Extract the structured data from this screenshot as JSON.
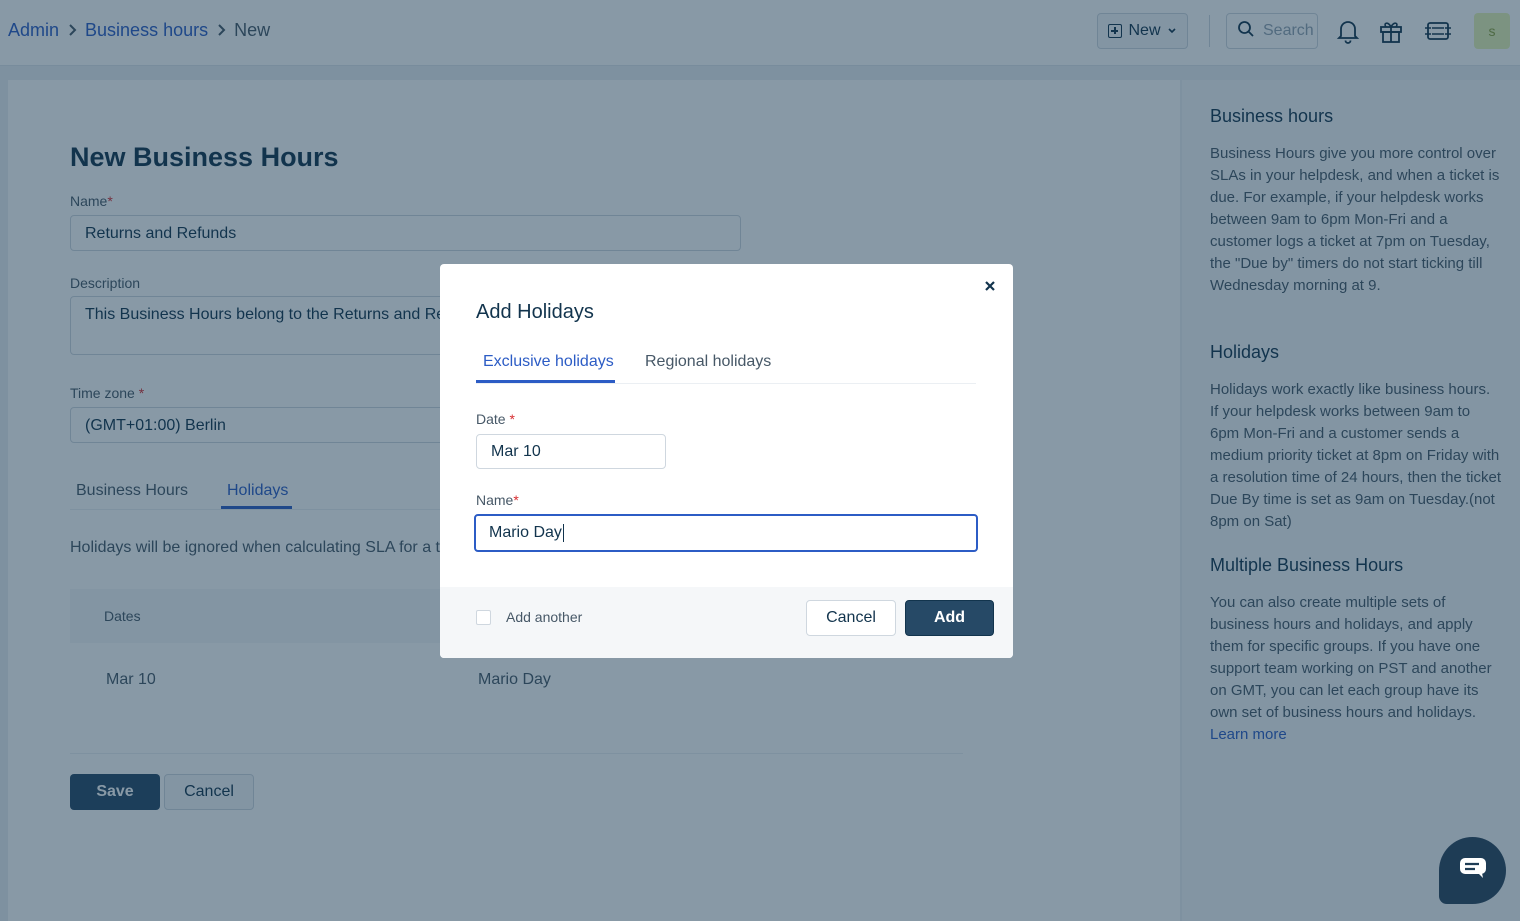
{
  "breadcrumb": {
    "items": [
      "Admin",
      "Business hours"
    ],
    "current": "New"
  },
  "topbar": {
    "new_label": "New",
    "search_placeholder": "Search",
    "avatar_initial": "s",
    "icons": [
      "plus-square-icon",
      "chevron-down-icon",
      "search-icon",
      "bell-icon",
      "gift-icon",
      "tickets-icon"
    ]
  },
  "form": {
    "title": "New Business Hours",
    "name_label": "Name",
    "name_value": "Returns and Refunds",
    "description_label": "Description",
    "description_value": "This Business Hours belong to the Returns and Ref",
    "timezone_label": "Time zone",
    "timezone_value": "(GMT+01:00) Berlin",
    "required_mark": "*",
    "tabs": [
      "Business Hours",
      "Holidays"
    ],
    "active_tab": "Holidays",
    "holidays_note": "Holidays will be ignored when calculating SLA for a tic",
    "table_header_dates": "Dates",
    "rows": [
      {
        "date": "Mar 10",
        "name": "Mario Day"
      }
    ],
    "save_label": "Save",
    "cancel_label": "Cancel"
  },
  "help": {
    "sections": [
      {
        "title": "Business hours",
        "body": "Business Hours give you more control over SLAs in your helpdesk, and when a ticket is due. For example, if your helpdesk works between 9am to 6pm Mon-Fri and a customer logs a ticket at 7pm on Tuesday, the \"Due by\" timers do not start ticking till Wednesday morning at 9."
      },
      {
        "title": "Holidays",
        "body": "Holidays work exactly like business hours. If your helpdesk works between 9am to 6pm Mon-Fri and a customer sends a medium priority ticket at 8pm on Friday with a resolution time of 24 hours, then the ticket Due By time is set as 9am on Tuesday.(not 8pm on Sat)"
      },
      {
        "title": "Multiple Business Hours",
        "body": "You can also create multiple sets of business hours and holidays, and apply them for specific groups. If you have one support team working on PST and another on GMT, you can let each group have its own set of business hours and holidays.",
        "link": "Learn more"
      }
    ]
  },
  "modal": {
    "title": "Add Holidays",
    "close_icon": "close-icon",
    "tabs": [
      "Exclusive holidays",
      "Regional holidays"
    ],
    "active_tab": "Exclusive holidays",
    "date_label": "Date",
    "date_value": "Mar 10",
    "name_label": "Name",
    "name_value": "Mario Day",
    "add_another_label": "Add another",
    "add_another_checked": false,
    "cancel_label": "Cancel",
    "add_label": "Add"
  },
  "colors": {
    "primary": "#264966",
    "link": "#2c5cc5",
    "required": "#d72d30",
    "text": "#12344d"
  }
}
